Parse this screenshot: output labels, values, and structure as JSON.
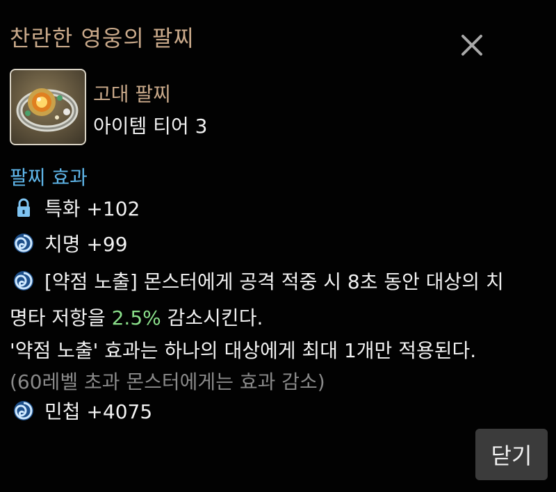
{
  "title": "찬란한 영웅의 팔찌",
  "item": {
    "grade": "고대 팔찌",
    "tier": "아이템 티어 3"
  },
  "effects": {
    "section_title": "팔찌 효과",
    "specialization": "특화 +102",
    "crit": "치명 +99",
    "weakpoint_line1": "[약점 노출] 몬스터에게 공격 적중 시 8초 동안 대상의 치",
    "weakpoint_line2_pre": "명타 저항을 ",
    "weakpoint_value": "2.5%",
    "weakpoint_line2_post": " 감소시킨다.",
    "weakpoint_line3": "'약점 노출' 효과는 하나의 대상에게 최대 1개만 적용된다.",
    "weakpoint_note": "(60레벨 초과 몬스터에게는 효과 감소)",
    "agility": "민첩 +4075"
  },
  "buttons": {
    "close_label": "닫기"
  },
  "icons": {
    "close": "close-icon",
    "lock": "lock-icon",
    "swirl": "swirl-icon"
  },
  "colors": {
    "title": "#c9a98a",
    "section": "#5fb6ea",
    "highlight": "#8be08b",
    "note": "#8a8a8a"
  }
}
